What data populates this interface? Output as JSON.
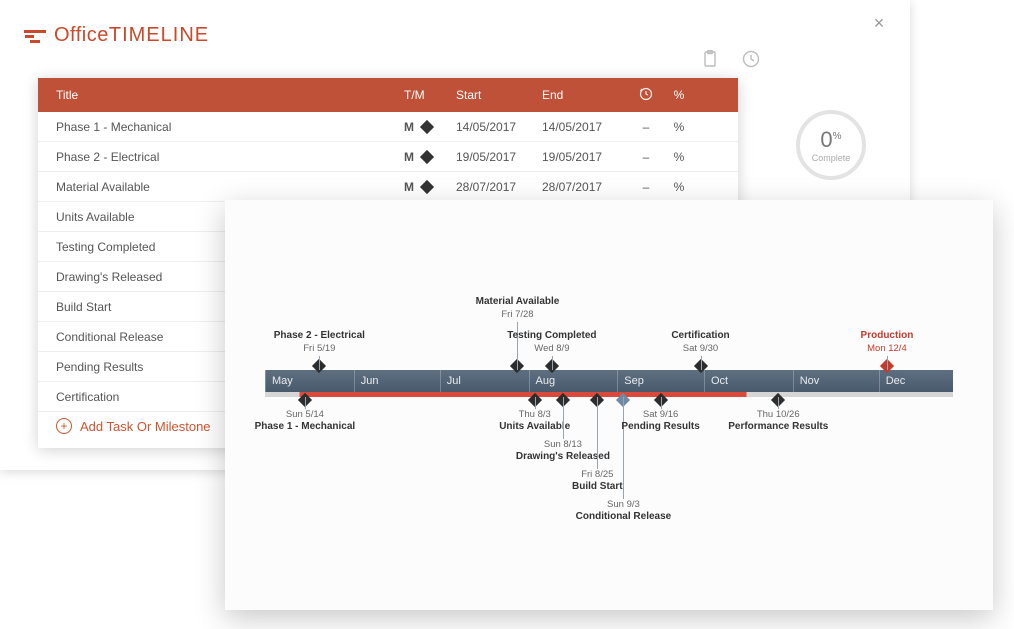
{
  "app": {
    "brand_light": "Office",
    "brand_bold": "TIMELINE"
  },
  "gauge": {
    "value": "0",
    "unit": "%",
    "label": "Complete"
  },
  "toolbar": {
    "clipboard": "clipboard-icon",
    "history": "history-icon"
  },
  "columns": {
    "title": "Title",
    "tm": "T/M",
    "start": "Start",
    "end": "End",
    "duration": "",
    "pct": "%"
  },
  "rows": [
    {
      "title": "Phase 1 - Mechanical",
      "tm": "M",
      "start": "14/05/2017",
      "end": "14/05/2017",
      "dur": "–",
      "pct": "%"
    },
    {
      "title": "Phase 2 - Electrical",
      "tm": "M",
      "start": "19/05/2017",
      "end": "19/05/2017",
      "dur": "–",
      "pct": "%"
    },
    {
      "title": "Material Available",
      "tm": "M",
      "start": "28/07/2017",
      "end": "28/07/2017",
      "dur": "–",
      "pct": "%"
    },
    {
      "title": "Units Available"
    },
    {
      "title": "Testing Completed"
    },
    {
      "title": "Drawing's Released"
    },
    {
      "title": "Build Start"
    },
    {
      "title": "Conditional Release"
    },
    {
      "title": "Pending Results"
    },
    {
      "title": "Certification"
    }
  ],
  "add_link": "Add Task Or Milestone",
  "timeline": {
    "months": [
      {
        "label": "May",
        "pct": 0.0
      },
      {
        "label": "Jun",
        "pct": 12.9
      },
      {
        "label": "Jul",
        "pct": 25.4
      },
      {
        "label": "Aug",
        "pct": 38.3
      },
      {
        "label": "Sep",
        "pct": 51.2
      },
      {
        "label": "Oct",
        "pct": 63.8
      },
      {
        "label": "Nov",
        "pct": 76.7
      },
      {
        "label": "Dec",
        "pct": 89.2
      }
    ],
    "above": [
      {
        "title": "Phase 2 - Electrical",
        "date": "Fri 5/19",
        "pct": 7.9,
        "conn": 14
      },
      {
        "title": "Material Available",
        "date": "Fri 7/28",
        "pct": 36.7,
        "conn": 48
      },
      {
        "title": "Testing Completed",
        "date": "Wed 8/9",
        "pct": 41.7,
        "conn": 14
      },
      {
        "title": "Certification",
        "date": "Sat 9/30",
        "pct": 63.3,
        "conn": 14
      },
      {
        "title": "Production",
        "date": "Mon 12/4",
        "pct": 90.4,
        "conn": 14,
        "red": true
      }
    ],
    "below": [
      {
        "title": "Phase 1 - Mechanical",
        "date": "Sun 5/14",
        "pct": 5.8,
        "conn": 12
      },
      {
        "title": "Units Available",
        "date": "Thu 8/3",
        "pct": 39.2,
        "conn": 12
      },
      {
        "title": "Drawing's Released",
        "date": "Sun 8/13",
        "pct": 43.3,
        "conn": 42
      },
      {
        "title": "Build Start",
        "date": "Fri 8/25",
        "pct": 48.3,
        "conn": 72
      },
      {
        "title": "Conditional Release",
        "date": "Sun 9/3",
        "pct": 52.1,
        "conn": 102,
        "blue": true
      },
      {
        "title": "Pending Results",
        "date": "Sat 9/16",
        "pct": 57.5,
        "conn": 12
      },
      {
        "title": "Performance Results",
        "date": "Thu 10/26",
        "pct": 74.6,
        "conn": 12
      }
    ]
  }
}
